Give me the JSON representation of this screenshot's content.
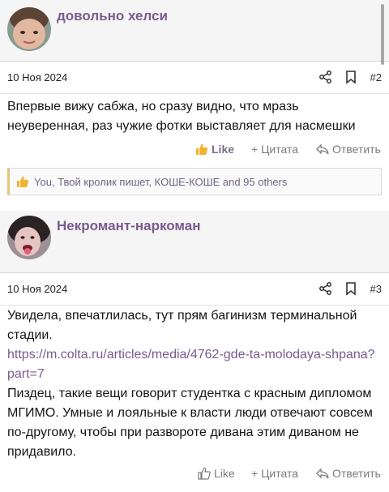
{
  "posts": [
    {
      "author": "довольно хелси",
      "date": "10 Ноя 2024",
      "number": "#2",
      "content": "Впервые вижу сабжа, но сразу видно, что мразь неуверенная, раз чужие фотки выставляет для насмешки",
      "actions": {
        "like": "Like",
        "quote": "+ Цитата",
        "reply": "Ответить"
      },
      "reactions": "You, Твой кролик пишет, КОШЕ-КОШЕ and 95 others"
    },
    {
      "author": "Некромант-наркоман",
      "date": "10 Ноя 2024",
      "number": "#3",
      "content_line1": "Увидела, впечатлилась, тут прям багинизм терминальной стадии.",
      "link": "https://m.colta.ru/articles/media/4762-gde-ta-molodaya-shpana?part=7",
      "content_line2": "Пиздец, такие вещи говорит студентка с красным дипломом МГИМО. Умные и лояльные к власти люди отвечают совсем по-другому, чтобы при развороте дивана этим диваном не придавило.",
      "actions": {
        "like": "Like",
        "quote": "+ Цитата",
        "reply": "Ответить"
      }
    }
  ],
  "icons": {
    "share": "share-icon",
    "bookmark": "bookmark-icon",
    "like": "thumbs-up-icon",
    "reply": "reply-arrow-icon"
  },
  "colors": {
    "accent": "#7a5a8e",
    "reaction_bar": "#e3c57a",
    "like_emoji": "#f2b331"
  }
}
